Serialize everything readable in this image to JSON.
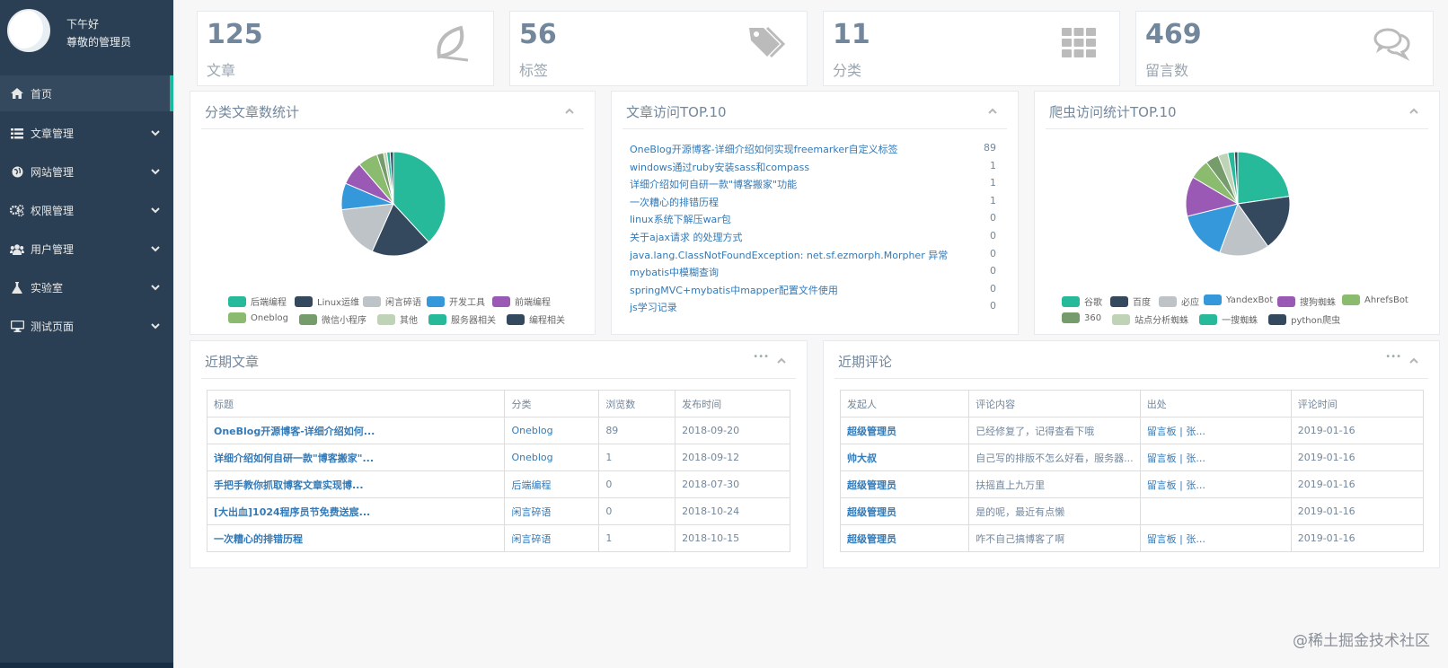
{
  "sidebar": {
    "greeting": "下午好",
    "admin_name": "尊敬的管理员",
    "items": [
      {
        "label": "首页",
        "icon": "home-icon"
      },
      {
        "label": "文章管理",
        "icon": "list-icon"
      },
      {
        "label": "网站管理",
        "icon": "globe-icon"
      },
      {
        "label": "权限管理",
        "icon": "gears-icon"
      },
      {
        "label": "用户管理",
        "icon": "users-icon"
      },
      {
        "label": "实验室",
        "icon": "flask-icon"
      },
      {
        "label": "测试页面",
        "icon": "desktop-icon"
      }
    ]
  },
  "tiles": [
    {
      "count": "125",
      "label": "文章",
      "icon": "leaf-icon"
    },
    {
      "count": "56",
      "label": "标签",
      "icon": "tags-icon"
    },
    {
      "count": "11",
      "label": "分类",
      "icon": "grid-icon"
    },
    {
      "count": "469",
      "label": "留言数",
      "icon": "comments-icon"
    }
  ],
  "panels": {
    "category_stats_title": "分类文章数统计",
    "top_articles_title": "文章访问TOP.10",
    "spider_title": "爬虫访问统计TOP.10",
    "recent_articles_title": "近期文章",
    "recent_comments_title": "近期评论"
  },
  "chart_data": [
    {
      "type": "pie",
      "categories": [
        "后端编程",
        "Linux运维",
        "闲言碎语",
        "开发工具",
        "前端编程",
        "Oneblog",
        "微信小程序",
        "其他",
        "服务器相关",
        "编程相关"
      ],
      "values": [
        37,
        18,
        16,
        8,
        7,
        6,
        2,
        1,
        1,
        1
      ],
      "colors": [
        "#26b99a",
        "#34495e",
        "#bdc3c7",
        "#3498db",
        "#9b59b6",
        "#8abb6f",
        "#759c6a",
        "#bfd3b7",
        "#26b99a",
        "#34495e"
      ]
    },
    {
      "type": "pie",
      "categories": [
        "谷歌",
        "百度",
        "必应",
        "YandexBot",
        "搜狗蜘蛛",
        "AhrefsBot",
        "360",
        "站点分析蜘蛛",
        "一搜蜘蛛",
        "python爬虫"
      ],
      "values": [
        22,
        17,
        15,
        15,
        12,
        6,
        4,
        3,
        2,
        1
      ],
      "colors": [
        "#26b99a",
        "#34495e",
        "#bdc3c7",
        "#3498db",
        "#9b59b6",
        "#8abb6f",
        "#759c6a",
        "#bfd3b7",
        "#26b99a",
        "#34495e"
      ]
    }
  ],
  "top_articles": [
    {
      "title": "OneBlog开源博客-详细介绍如何实现freemarker自定义标签",
      "count": "89"
    },
    {
      "title": "windows通过ruby安装sass和compass",
      "count": "1"
    },
    {
      "title": "详细介绍如何自研一款\"博客搬家\"功能",
      "count": "1"
    },
    {
      "title": "一次糟心的排错历程",
      "count": "1"
    },
    {
      "title": "linux系统下解压war包",
      "count": "0"
    },
    {
      "title": "关于ajax请求 的处理方式",
      "count": "0"
    },
    {
      "title": "java.lang.ClassNotFoundException: net.sf.ezmorph.Morpher 异常",
      "count": "0"
    },
    {
      "title": "mybatis中模糊查询",
      "count": "0"
    },
    {
      "title": "springMVC+mybatis中mapper配置文件使用",
      "count": "0"
    },
    {
      "title": "js学习记录",
      "count": "0"
    }
  ],
  "recent_articles": {
    "headers": [
      "标题",
      "分类",
      "浏览数",
      "发布时间"
    ],
    "rows": [
      [
        "OneBlog开源博客-详细介绍如何...",
        "Oneblog",
        "89",
        "2018-09-20"
      ],
      [
        "详细介绍如何自研一款\"博客搬家\"...",
        "Oneblog",
        "1",
        "2018-09-12"
      ],
      [
        "手把手教你抓取博客文章实现博...",
        "后端编程",
        "0",
        "2018-07-30"
      ],
      [
        "[大出血]1024程序员节免费送宸...",
        "闲言碎语",
        "0",
        "2018-10-24"
      ],
      [
        "一次糟心的排错历程",
        "闲言碎语",
        "1",
        "2018-10-15"
      ]
    ]
  },
  "recent_comments": {
    "headers": [
      "发起人",
      "评论内容",
      "出处",
      "评论时间"
    ],
    "rows": [
      [
        "超级管理员",
        "已经修复了，记得查看下哦",
        "留言板 | 张...",
        "2019-01-16"
      ],
      [
        "帅大叔",
        "自己写的排版不怎么好看，服务器...",
        "留言板 | 张...",
        "2019-01-16"
      ],
      [
        "超级管理员",
        "扶摇直上九万里",
        "留言板 | 张...",
        "2019-01-16"
      ],
      [
        "超级管理员",
        "是的呢，最近有点懒",
        "",
        "2019-01-16"
      ],
      [
        "超级管理员",
        "咋不自己搞博客了啊",
        "留言板 | 张...",
        "2019-01-16"
      ]
    ]
  },
  "watermark": "@稀土掘金技术社区"
}
